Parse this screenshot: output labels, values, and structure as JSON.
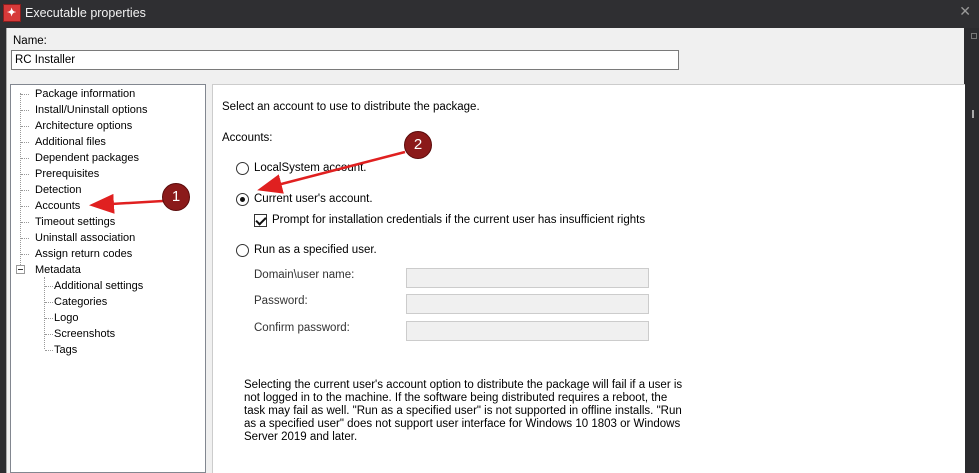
{
  "window": {
    "title": "Executable properties",
    "close_glyph": "✕"
  },
  "name": {
    "label": "Name:",
    "value": "RC Installer"
  },
  "tree": {
    "items": [
      "Package information",
      "Install/Uninstall options",
      "Architecture options",
      "Additional files",
      "Dependent packages",
      "Prerequisites",
      "Detection",
      "Accounts",
      "Timeout settings",
      "Uninstall association",
      "Assign return codes",
      "Metadata"
    ],
    "metadata_children": [
      "Additional settings",
      "Categories",
      "Logo",
      "Screenshots",
      "Tags"
    ]
  },
  "content": {
    "intro": "Select an account to use to distribute the package.",
    "accounts_label": "Accounts:",
    "option_localsystem": "LocalSystem account.",
    "option_current_user": "Current user's account.",
    "prompt_checkbox": "Prompt for installation credentials if the current user has insufficient rights",
    "option_specified_user": "Run as a specified user.",
    "domain_user_label": "Domain\\user name:",
    "password_label": "Password:",
    "confirm_password_label": "Confirm password:",
    "note": "Selecting the current user's account option to distribute the package will fail if a user is not logged in to the machine. If the software being distributed requires a reboot, the task may fail as well.  \"Run as a specified user\" is not supported in offline installs. \"Run as a specified user\" does not support user interface for Windows 10 1803 or Windows Server 2019 and later."
  },
  "annotations": {
    "badge1": "1",
    "badge2": "2"
  },
  "colors": {
    "annotation": "#e02020",
    "badge": "#8b1a1a",
    "titlebar": "#2f2f32"
  }
}
